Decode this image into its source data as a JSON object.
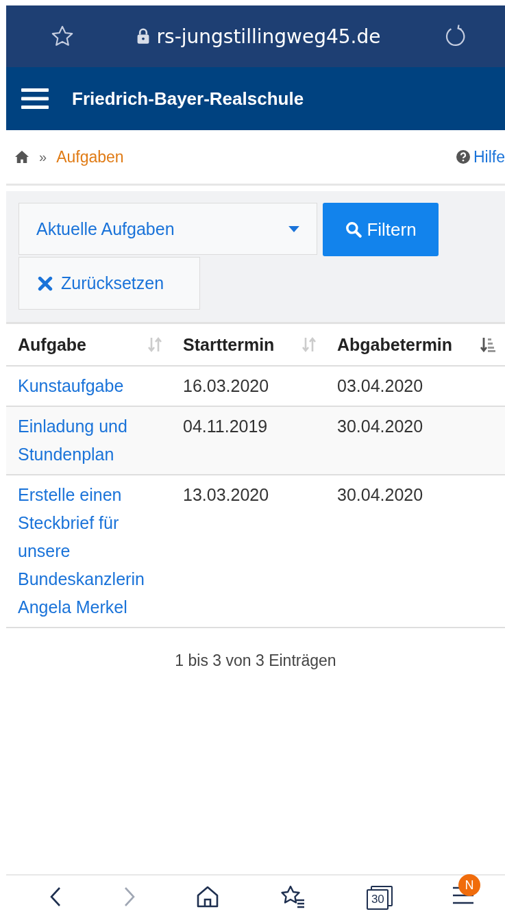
{
  "browser": {
    "url": "rs-jungstillingweg45.de"
  },
  "header": {
    "title": "Friedrich-Bayer-Realschule"
  },
  "breadcrumb": {
    "separator": "»",
    "current": "Aufgaben",
    "help": "Hilfe"
  },
  "filter": {
    "select_value": "Aktuelle Aufgaben",
    "filter_button": "Filtern",
    "reset_button": "Zurücksetzen"
  },
  "table": {
    "columns": [
      {
        "label": "Aufgabe",
        "sorted": false
      },
      {
        "label": "Starttermin",
        "sorted": false
      },
      {
        "label": "Abgabetermin",
        "sorted": true
      }
    ],
    "rows": [
      {
        "title": "Kunstaufgabe",
        "start": "16.03.2020",
        "due": "03.04.2020"
      },
      {
        "title": "Einladung und Stundenplan",
        "start": "04.11.2019",
        "due": "30.04.2020"
      },
      {
        "title": "Erstelle einen Steckbrief für unsere Bundeskanzlerin Angela Merkel",
        "start": "13.03.2020",
        "due": "30.04.2020"
      }
    ]
  },
  "table_info": "1 bis 3 von 3 Einträgen",
  "bottom_nav": {
    "back_disabled": false,
    "forward_disabled": true,
    "tab_count": "30",
    "menu_badge": "N"
  }
}
